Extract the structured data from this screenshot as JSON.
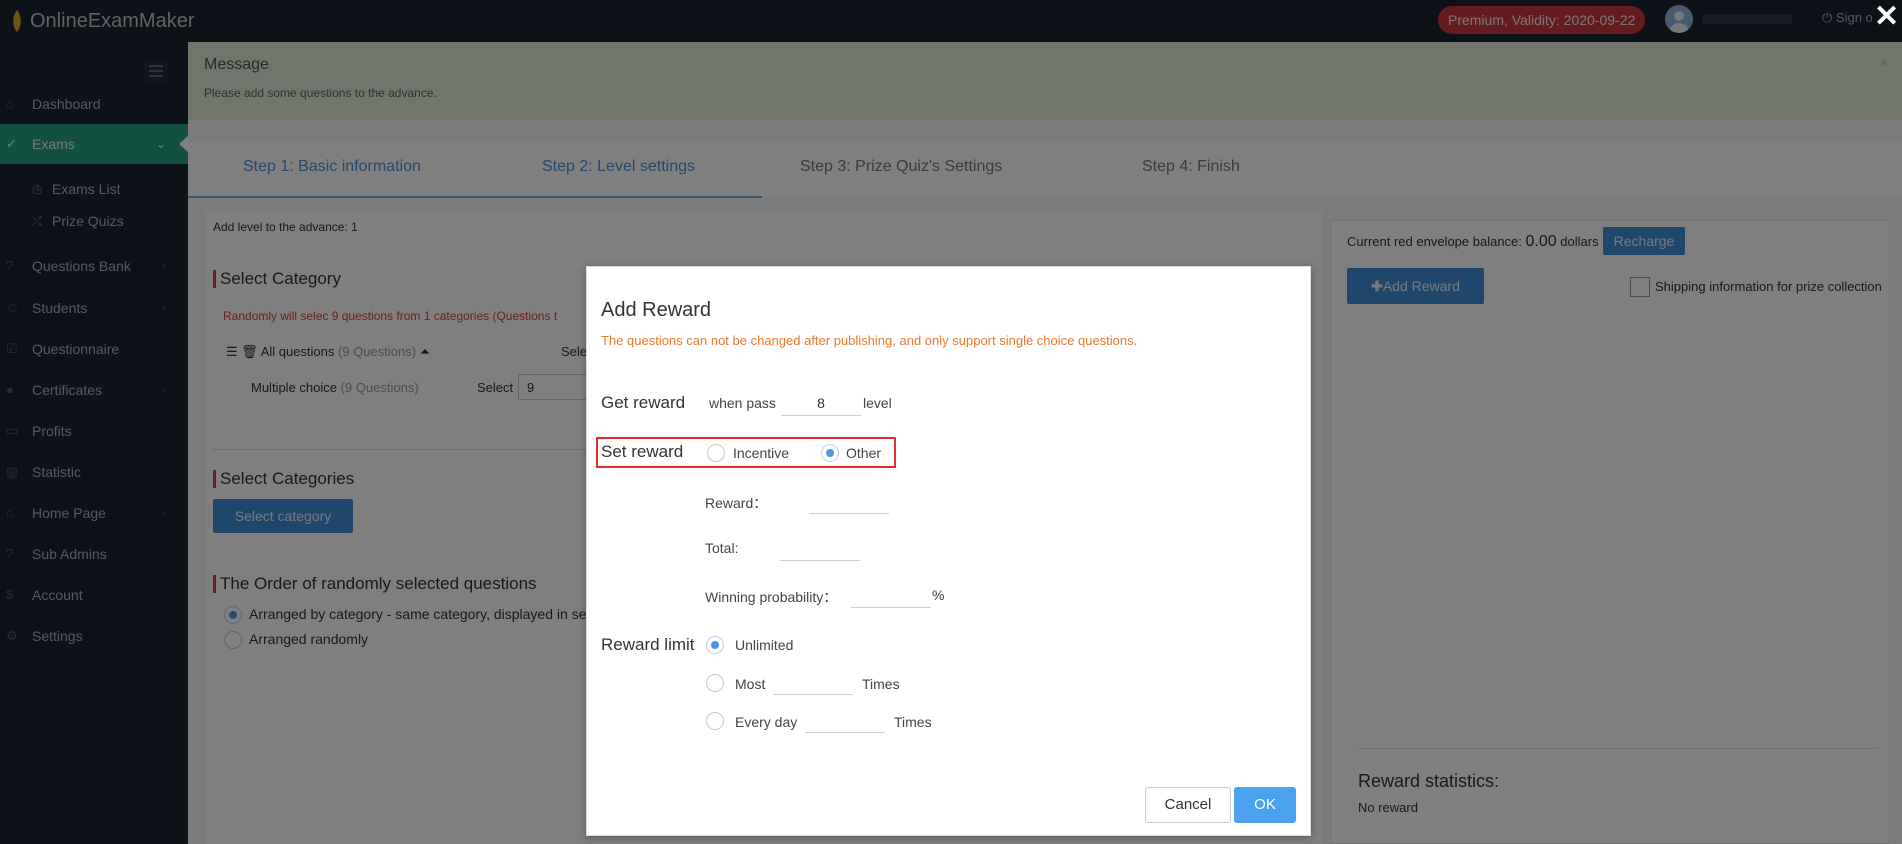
{
  "app": {
    "brand": "OnlineExamMaker",
    "premium": "Premium, Validity: 2020-09-22",
    "sign_out": "Sign o"
  },
  "sidebar": {
    "items": [
      {
        "label": "Dashboard",
        "icon": "home-icon"
      },
      {
        "label": "Exams",
        "icon": "check-circle-icon"
      },
      {
        "label": "Questions Bank",
        "icon": "question-icon"
      },
      {
        "label": "Students",
        "icon": "users-icon"
      },
      {
        "label": "Questionnaire",
        "icon": "checkbox-icon"
      },
      {
        "label": "Certificates",
        "icon": "certificate-icon"
      },
      {
        "label": "Profits",
        "icon": "card-icon"
      },
      {
        "label": "Statistic",
        "icon": "bar-chart-icon"
      },
      {
        "label": "Home Page",
        "icon": "home-page-icon"
      },
      {
        "label": "Sub Admins",
        "icon": "help-icon"
      },
      {
        "label": "Account",
        "icon": "dollar-icon"
      },
      {
        "label": "Settings",
        "icon": "gear-icon"
      }
    ],
    "subitems": [
      {
        "label": "Exams List",
        "icon": "clock-icon"
      },
      {
        "label": "Prize Quizs",
        "icon": "shuffle-icon"
      }
    ]
  },
  "message": {
    "title": "Message",
    "text": "Please add some questions to the advance."
  },
  "steps": [
    "Step 1: Basic information",
    "Step 2: Level settings",
    "Step 3:  Prize Quiz's Settings",
    "Step 4: Finish"
  ],
  "left": {
    "add_level": "Add level to the advance: 1",
    "select_category_title": "Select Category",
    "random_note": "Randomly will selec 9 questions from 1 categories (Questions t",
    "all_questions": "All questions",
    "all_questions_count": "(9 Questions)",
    "sele_label": "Sele",
    "multiple_choice": "Multiple choice",
    "mc_count": "(9 Questions)",
    "select_label": "Select",
    "select_value": "9",
    "select_categories_title": "Select Categories",
    "select_category_button": "Select category",
    "order_title": "The Order of randomly selected questions",
    "order_option1": "Arranged by category - same category, displayed in se",
    "order_option2": "Arranged randomly"
  },
  "right": {
    "balance_label": "Current red envelope balance:",
    "balance_value": "0.00",
    "balance_unit": "dollars",
    "recharge": "Recharge",
    "add_reward": "Add Reward",
    "shipping": "Shipping information for prize collection",
    "stats_title": "Reward statistics:",
    "stats_text": "No reward"
  },
  "dialog": {
    "title": "Add Reward",
    "warning": "The questions can not be changed after publishing, and only support single choice questions.",
    "get_reward": "Get reward",
    "when_pass": "when pass",
    "level_value": "8",
    "level": "level",
    "set_reward": "Set reward",
    "incentive": "Incentive",
    "other": "Other",
    "reward_label": "Reward：",
    "total_label": "Total:",
    "winning_label": "Winning probability：",
    "percent": "%",
    "reward_limit": "Reward limit",
    "unlimited": "Unlimited",
    "most": "Most",
    "times1": "Times",
    "every_day": "Every day",
    "times2": "Times",
    "cancel": "Cancel",
    "ok": "OK"
  },
  "colors": {
    "accent": "#4da2f0",
    "sidebar": "#1b2431",
    "active": "#25a182",
    "warning": "#e8792f",
    "highlight": "#e32f2f"
  }
}
